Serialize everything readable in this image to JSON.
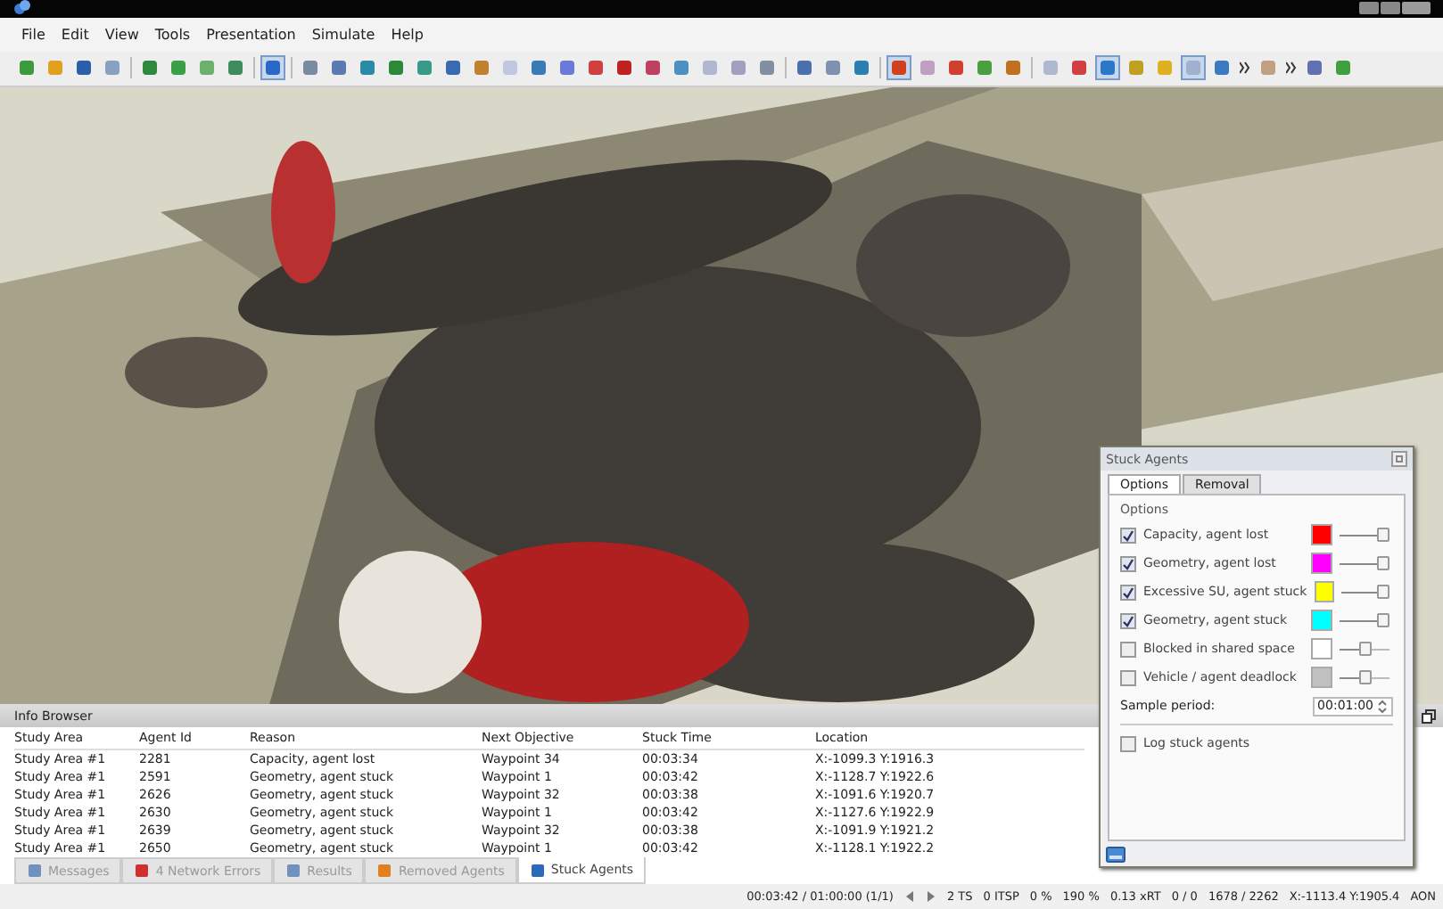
{
  "menu": [
    "File",
    "Edit",
    "View",
    "Tools",
    "Presentation",
    "Simulate",
    "Help"
  ],
  "info_browser": {
    "title": "Info Browser",
    "columns": [
      "Study Area",
      "Agent Id",
      "Reason",
      "Next Objective",
      "Stuck Time",
      "Location"
    ],
    "rows": [
      [
        "Study Area #1",
        "2281",
        "Capacity, agent lost",
        "Waypoint 34",
        "00:03:34",
        "X:-1099.3 Y:1916.3"
      ],
      [
        "Study Area #1",
        "2591",
        "Geometry, agent stuck",
        "Waypoint 1",
        "00:03:42",
        "X:-1128.7 Y:1922.6"
      ],
      [
        "Study Area #1",
        "2626",
        "Geometry, agent stuck",
        "Waypoint 32",
        "00:03:38",
        "X:-1091.6 Y:1920.7"
      ],
      [
        "Study Area #1",
        "2630",
        "Geometry, agent stuck",
        "Waypoint 1",
        "00:03:42",
        "X:-1127.6 Y:1922.9"
      ],
      [
        "Study Area #1",
        "2639",
        "Geometry, agent stuck",
        "Waypoint 32",
        "00:03:38",
        "X:-1091.9 Y:1921.2"
      ],
      [
        "Study Area #1",
        "2650",
        "Geometry, agent stuck",
        "Waypoint 1",
        "00:03:42",
        "X:-1128.1 Y:1922.2"
      ]
    ],
    "tabs": [
      {
        "label": "Messages",
        "selected": false
      },
      {
        "label": "4 Network Errors",
        "selected": false
      },
      {
        "label": "Results",
        "selected": false
      },
      {
        "label": "Removed Agents",
        "selected": false
      },
      {
        "label": "Stuck Agents",
        "selected": true
      }
    ]
  },
  "status_bar": {
    "time": "00:03:42 / 01:00:00 (1/1)",
    "fields": [
      "2 TS",
      "0 ITSP",
      "0 %",
      "190 %",
      "0.13 xRT",
      "0 / 0",
      "1678 / 2262",
      "X:-1113.4 Y:1905.4",
      "AON"
    ]
  },
  "dialog": {
    "title": "Stuck Agents",
    "tabs": [
      {
        "label": "Options",
        "selected": true
      },
      {
        "label": "Removal",
        "selected": false
      }
    ],
    "group": "Options",
    "options": [
      {
        "label": "Capacity, agent lost",
        "checked": true,
        "color": "#ff0000",
        "level": 1
      },
      {
        "label": "Geometry, agent lost",
        "checked": true,
        "color": "#ff00ff",
        "level": 1
      },
      {
        "label": "Excessive SU, agent stuck",
        "checked": true,
        "color": "#ffff00",
        "level": 1
      },
      {
        "label": "Geometry, agent stuck",
        "checked": true,
        "color": "#00ffff",
        "level": 1
      },
      {
        "label": "Blocked in shared space",
        "checked": false,
        "color": "#ffffff",
        "level": 0.5
      },
      {
        "label": "Vehicle / agent deadlock",
        "checked": false,
        "color": "#c0c0c0",
        "level": 0.5
      }
    ],
    "sample_period": {
      "label": "Sample period:",
      "value": "00:01:00"
    },
    "log": {
      "label": "Log stuck agents",
      "checked": false
    }
  }
}
